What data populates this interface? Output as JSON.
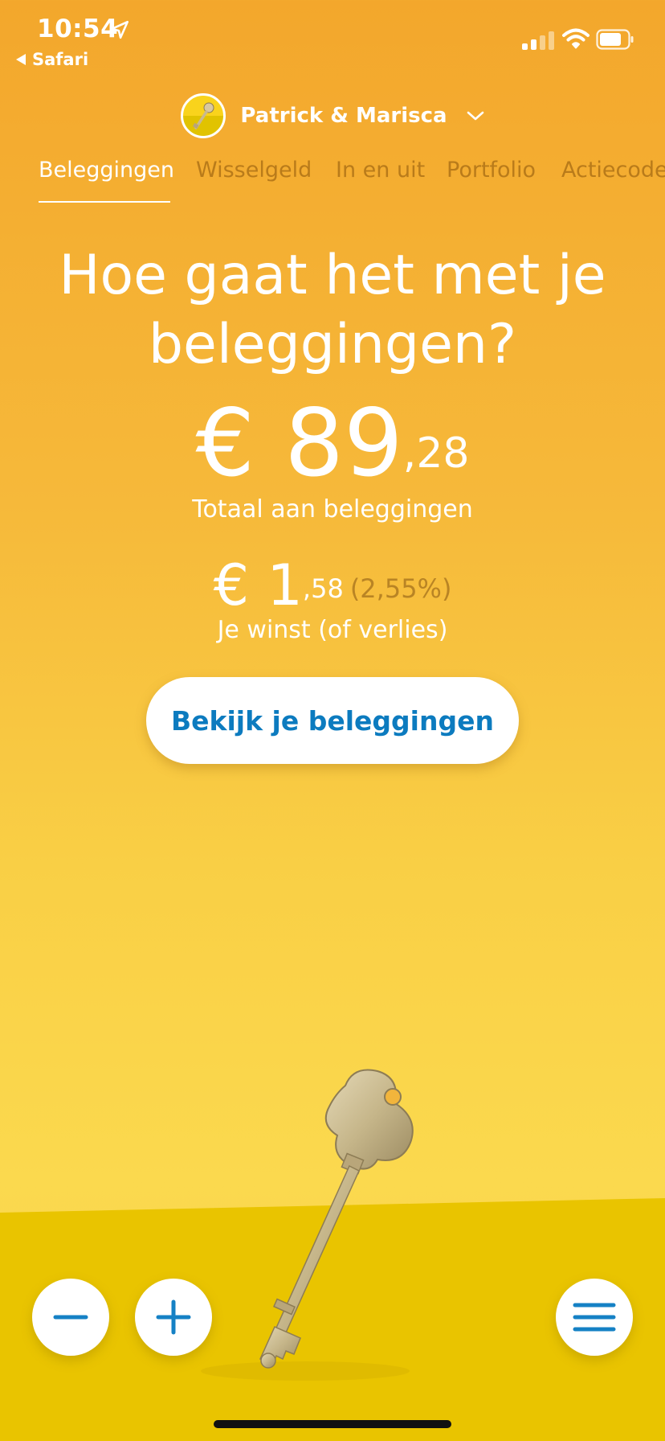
{
  "status_bar": {
    "time": "10:54",
    "back_app": "Safari",
    "icons": [
      "location-arrow-icon",
      "cellular-signal-icon",
      "wifi-icon",
      "battery-icon"
    ]
  },
  "header": {
    "account_name": "Patrick & Marisca",
    "avatar_icon": "key-avatar-icon",
    "dropdown_icon": "chevron-down-icon"
  },
  "tabs": [
    {
      "label": "Beleggingen",
      "active": true
    },
    {
      "label": "Wisselgeld",
      "active": false
    },
    {
      "label": "In en uit",
      "active": false
    },
    {
      "label": "Portfolio",
      "active": false
    },
    {
      "label": "Actiecode",
      "active": false
    }
  ],
  "main": {
    "headline_line1": "Hoe gaat het met je",
    "headline_line2": "beleggingen?",
    "total": {
      "currency": "€",
      "whole": "89",
      "cents": ",28"
    },
    "total_label": "Totaal aan beleggingen",
    "gain": {
      "currency": "€",
      "whole": "1",
      "cents": ",58",
      "percent": "(2,55%)"
    },
    "gain_label": "Je winst (of verlies)",
    "cta_label": "Bekijk je beleggingen"
  },
  "bottom_actions": {
    "minus_icon": "minus-icon",
    "plus_icon": "plus-icon",
    "menu_icon": "hamburger-menu-icon"
  },
  "colors": {
    "accent_blue": "#0c7bbf",
    "inactive_tab": "#b97b1a",
    "background_top": "#f3a72c",
    "background_bottom": "#fbd94e",
    "floor": "#e9c400"
  }
}
